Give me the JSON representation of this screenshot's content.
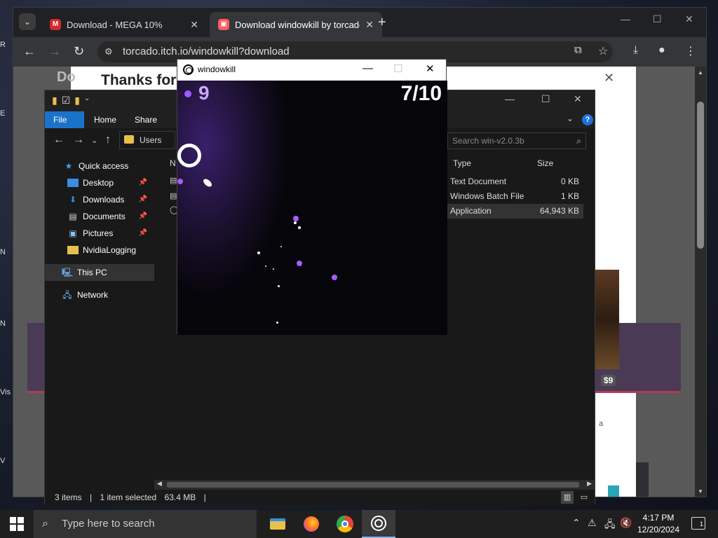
{
  "desktop": {
    "icon_fragments": [
      "R",
      "E",
      "N",
      "N",
      "Vis",
      "V"
    ]
  },
  "chrome": {
    "tabs": [
      {
        "title": "Download - MEGA 10%",
        "favicon_letter": "M",
        "color": "#d9272e"
      },
      {
        "title": "Download windowkill by torcado",
        "favicon_letter": "",
        "color": "#fa5c5c"
      }
    ],
    "url": "torcado.itch.io/windowkill?download",
    "page": {
      "heading": "Thanks for d",
      "heading_fragment": "Do",
      "price": "$9",
      "side_fragment": "a"
    }
  },
  "explorer": {
    "ribbon": {
      "file": "File",
      "home": "Home",
      "share": "Share"
    },
    "address": "Users",
    "search_placeholder": "Search win-v2.0.3b",
    "nav": [
      {
        "label": "Quick access",
        "icon": "star-icon"
      },
      {
        "label": "Desktop",
        "icon": "desktop-icon",
        "pinned": true
      },
      {
        "label": "Downloads",
        "icon": "downloads-icon",
        "pinned": true
      },
      {
        "label": "Documents",
        "icon": "documents-icon",
        "pinned": true
      },
      {
        "label": "Pictures",
        "icon": "pictures-icon",
        "pinned": true
      },
      {
        "label": "NvidiaLogging",
        "icon": "folder-icon"
      },
      {
        "label": "This PC",
        "icon": "pc-icon"
      },
      {
        "label": "Network",
        "icon": "network-icon"
      }
    ],
    "columns": {
      "name": "N",
      "type": "Type",
      "size": "Size"
    },
    "files": [
      {
        "type": "Text Document",
        "size": "0 KB"
      },
      {
        "type": "Windows Batch File",
        "size": "1 KB"
      },
      {
        "type": "Application",
        "size": "64,943 KB"
      }
    ],
    "status": {
      "items": "3 items",
      "selected": "1 item selected",
      "size": "63.4 MB"
    }
  },
  "game": {
    "title": "windowkill",
    "score": "9",
    "wave": "7/10"
  },
  "taskbar": {
    "search_placeholder": "Type here to search",
    "time": "4:17 PM",
    "date": "12/20/2024",
    "notification_count": "1"
  },
  "colors": {
    "accent_blue": "#1a73c9",
    "game_purple": "#a75cff",
    "itch_red": "#fa5c5c"
  }
}
